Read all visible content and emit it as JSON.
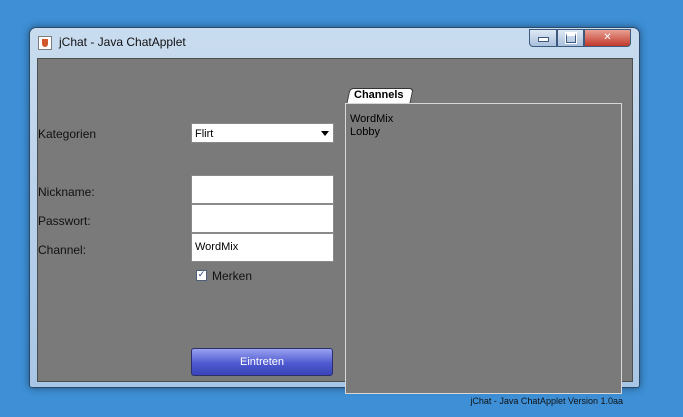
{
  "window": {
    "title": "jChat - Java ChatApplet",
    "controls": {
      "minimize_icon": "minimize-icon",
      "maximize_icon": "maximize-icon",
      "close_label": "✕"
    }
  },
  "form": {
    "kategorien_label": "Kategorien",
    "kategorien_value": "Flirt",
    "nickname_label": "Nickname:",
    "nickname_value": "",
    "passwort_label": "Passwort:",
    "passwort_value": "",
    "channel_label": "Channel:",
    "channel_value": "WordMix",
    "merken_label": "Merken",
    "merken_checked": true,
    "merken_mark": "✓",
    "submit_label": "Eintreten"
  },
  "channels": {
    "tab_label": "Channels",
    "items": [
      "WordMix",
      "Lobby"
    ]
  },
  "footer": {
    "version": "jChat - Java ChatApplet Version 1.0aa"
  },
  "colors": {
    "desktop": "#3e8fd6",
    "content_bg": "#7a7a7a",
    "button_accent": "#4f5ad0"
  }
}
